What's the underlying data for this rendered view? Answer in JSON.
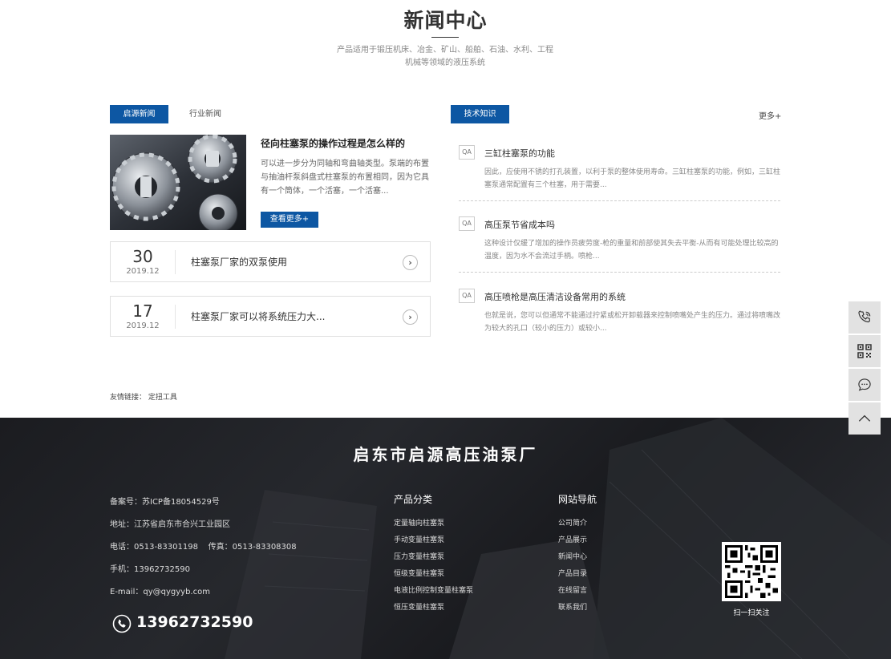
{
  "section": {
    "title": "新闻中心",
    "subtitle": "产品适用于锻压机床、冶金、矿山、船舶、石油、水利、工程机械等领域的液压系统"
  },
  "left_tabs": [
    "启源新闻",
    "行业新闻"
  ],
  "right_tab": "技术知识",
  "more_label": "更多+",
  "feature": {
    "title": "径向柱塞泵的操作过程是怎么样的",
    "desc": "可以进一步分为同轴和弯曲轴类型。泵端的布置与抽油杆泵斜盘式柱塞泵的布置相同，因为它具有一个筒体，一个活塞，一个活塞...",
    "button": "查看更多+"
  },
  "news_rows": [
    {
      "day": "30",
      "ym": "2019.12",
      "title": "柱塞泵厂家的双泵使用"
    },
    {
      "day": "17",
      "ym": "2019.12",
      "title": "柱塞泵厂家可以将系统压力大..."
    }
  ],
  "qa_items": [
    {
      "badge": "QA",
      "title": "三缸柱塞泵的功能",
      "desc": "因此，应使用不锈的打孔装置，以利于泵的整体使用寿命。三缸柱塞泵的功能，例如，三缸柱塞泵通常配置有三个柱塞，用于需要..."
    },
    {
      "badge": "QA",
      "title": "高压泵节省成本吗",
      "desc": "这种设计仅缓了增加的操作员疲劳度-枪的重量和前部使其失去平衡-从而有可能处理比较高的温度，因为水不会流过手柄。喷枪..."
    },
    {
      "badge": "QA",
      "title": "高压喷枪是高压清洁设备常用的系统",
      "desc": "也就是说，您可以但通常不能通过拧紧或松开卸载器来控制喷嘴处产生的压力。通过将喷嘴改为较大的孔口（较小的压力）或较小..."
    }
  ],
  "friend_links": {
    "label": "友情链接：",
    "items": [
      "定扭工具"
    ]
  },
  "footer": {
    "company": "启东市启源高压油泵厂",
    "info": [
      "备案号：苏ICP备18054529号",
      "地址：江苏省启东市合兴工业园区",
      "电话：0513-83301198    传真：0513-83308308",
      "手机：13962732590",
      "E-mail：qy@qygyyb.com"
    ],
    "hotline": "13962732590",
    "products": {
      "heading": "产品分类",
      "items": [
        "定量轴向柱塞泵",
        "手动变量柱塞泵",
        "压力变量柱塞泵",
        "恒级变量柱塞泵",
        "电液比例控制变量柱塞泵",
        "恒压变量柱塞泵"
      ]
    },
    "nav": {
      "heading": "网站导航",
      "items": [
        "公司简介",
        "产品展示",
        "新闻中心",
        "产品目录",
        "在线留言",
        "联系我们"
      ]
    },
    "qr_label": "扫一扫关注"
  },
  "colors": {
    "accent": "#0d57a3",
    "footer_bg": "#1f2024",
    "sidebar_bg": "#e2e2e2"
  },
  "sidebar_icons": [
    "phone-icon",
    "qrcode-icon",
    "chat-icon",
    "arrow-up-icon"
  ]
}
